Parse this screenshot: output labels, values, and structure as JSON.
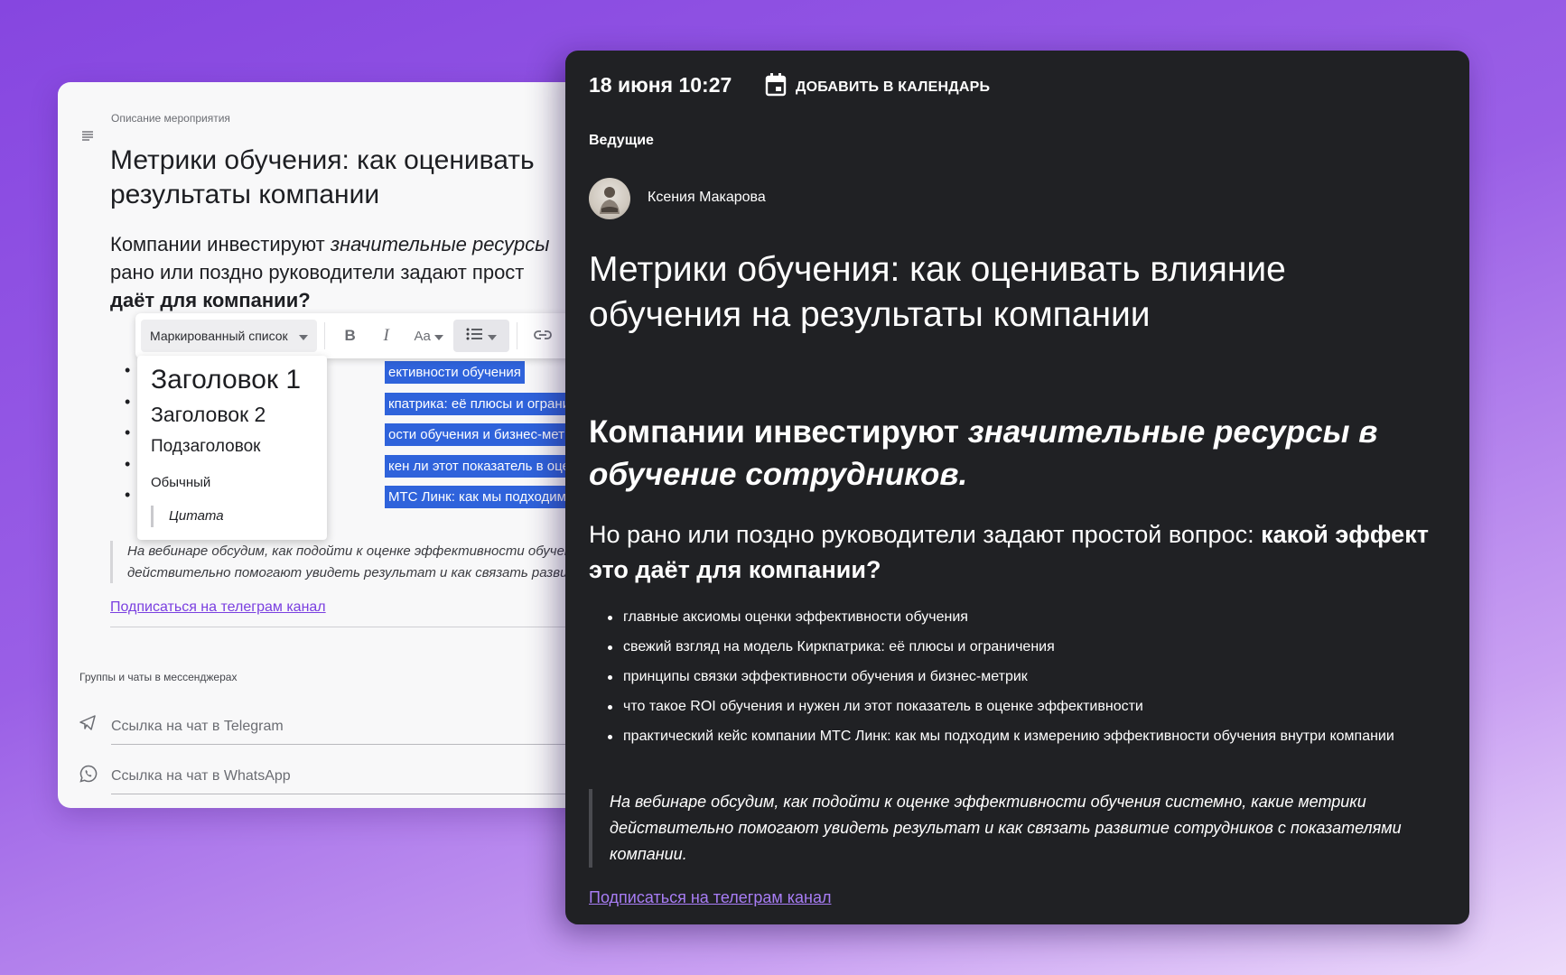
{
  "editor": {
    "field_label": "Описание мероприятия",
    "title": "Метрики обучения: как оценивать результаты компании",
    "lead": {
      "line1_plain": "Компании инвестируют ",
      "line1_italic": "значительные ресурсы",
      "line2": "рано или поздно руководители задают прост",
      "line3_bold": "даёт для компании?"
    },
    "toolbar": {
      "block_type": "Маркированный список",
      "bold": "B",
      "italic": "I",
      "font_size": "Aa"
    },
    "list_items": [
      "ективности обучения",
      "кпатрика: её плюсы и ограничения",
      "ости обучения и бизнес-метрик",
      "кен ли этот показатель в оценке эфф",
      "МТС Линк: как мы подходим к измер"
    ],
    "dropdown": {
      "heading1": "Заголовок 1",
      "heading2": "Заголовок 2",
      "subheading": "Подзаголовок",
      "normal": "Обычный",
      "quote": "Цитата"
    },
    "blockquote_lines": [
      "На вебинаре обсудим, как подойти к оценке эффективности обучен",
      "действительно помогают увидеть результат и как связать развити"
    ],
    "link": "Подписаться на телеграм канал",
    "groups_label": "Группы и чаты в мессенджерах",
    "telegram_placeholder": "Ссылка на чат в Telegram",
    "whatsapp_placeholder": "Ссылка на чат в WhatsApp"
  },
  "preview": {
    "datetime": "18 июня 10:27",
    "add_to_calendar": "ДОБАВИТЬ В КАЛЕНДАРЬ",
    "hosts_label": "Ведущие",
    "host_name": "Ксения Макарова",
    "title": "Метрики обучения: как оценивать влияние обучения на результаты компании",
    "lead_plain": "Компании инвестируют ",
    "lead_italic": "значительные ресурсы в обучение сотрудников.",
    "sub_plain": "Но рано или поздно руководители задают простой вопрос: ",
    "sub_bold": "какой эффект это даёт для компании?",
    "list_items": [
      "главные аксиомы оценки эффективности обучения",
      "свежий взгляд на модель Киркпатрика: её плюсы и ограничения",
      "принципы связки эффективности обучения и бизнес-метрик",
      "что такое ROI обучения и нужен ли этот показатель в оценке эффективности",
      "практический кейс компании МТС Линк: как мы подходим к измерению эффективности обучения внутри компании"
    ],
    "quote": "На вебинаре обсудим, как подойти к оценке эффективности обучения системно, какие метрики действительно помогают увидеть результат и как связать развитие сотрудников с показателями компании.",
    "link": "Подписаться на телеграм канал"
  },
  "colors": {
    "background_start": "#8646e0",
    "preview_bg": "#202124",
    "selection": "#2f63db",
    "link_light": "#7a3fe0",
    "link_dark": "#a87df5"
  }
}
